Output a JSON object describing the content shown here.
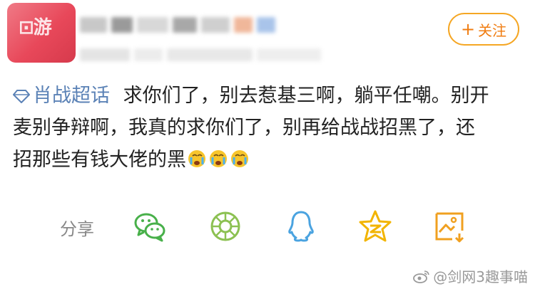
{
  "post": {
    "topic": "肖战超话",
    "text_line1": "求你们了，别去惹基三啊，躺平任嘲。别开",
    "text_line2": "麦别争辩啊，我真的求你们了，别再给战战招黑了，还",
    "text_line3": "招那些有钱大佬的黑"
  },
  "follow": {
    "plus": "+",
    "label": "关注"
  },
  "share": {
    "label": "分享",
    "targets": [
      "wechat-icon",
      "moments-icon",
      "qq-icon",
      "qzone-icon",
      "save-image-icon"
    ]
  },
  "watermark": "@剑网3趣事喵",
  "colors": {
    "topic": "#5b82b6",
    "accent": "#f07c10",
    "icon_green": "#48b04a",
    "icon_blue": "#4aa3e0",
    "icon_yellow": "#f2b400",
    "icon_orange": "#f0a020"
  }
}
